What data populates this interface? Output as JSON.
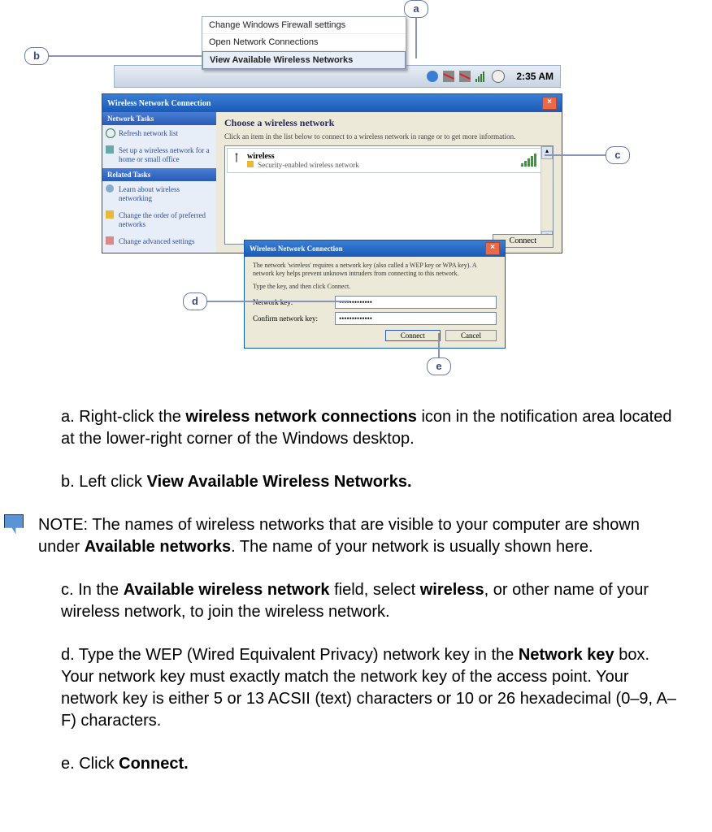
{
  "callouts": {
    "a": "a",
    "b": "b",
    "c": "c",
    "d": "d",
    "e": "e"
  },
  "contextMenu": {
    "item1": "Change Windows Firewall settings",
    "item2": "Open Network Connections",
    "item3": "View Available Wireless Networks"
  },
  "taskbar": {
    "clock": "2:35 AM"
  },
  "wnc": {
    "title": "Wireless Network Connection",
    "tasksHdr": "Network Tasks",
    "task1": "Refresh network list",
    "task2": "Set up a wireless network for a home or small office",
    "relatedHdr": "Related Tasks",
    "rel1": "Learn about wireless networking",
    "rel2": "Change the order of preferred networks",
    "rel3": "Change advanced settings",
    "mainHdr": "Choose a wireless network",
    "mainSub": "Click an item in the list below to connect to a wireless network in range or to get more information.",
    "netName": "wireless",
    "netSec": "Security-enabled wireless network",
    "connect": "Connect"
  },
  "keydlg": {
    "title": "Wireless Network Connection",
    "desc1": "The network 'wireless' requires a network key (also called a WEP key or WPA key). A network key helps prevent unknown intruders from connecting to this network.",
    "desc2": "Type the key, and then click Connect.",
    "lbl1": "Network key:",
    "lbl2": "Confirm network key:",
    "val": "•••••••••••••",
    "connect": "Connect",
    "cancel": "Cancel"
  },
  "text": {
    "a_pre": "a. Right-click the ",
    "a_b": "wireless network connections",
    "a_post": " icon in the notification area located at the lower-right corner of the Windows desktop.",
    "b_pre": "b. Left click ",
    "b_b": "View Available Wireless Networks.",
    "note_pre": "NOTE: The names of wireless networks that are visible to your computer are shown under ",
    "note_b": "Available networks",
    "note_post": ". The name of your network is usually shown here.",
    "c_pre": "c. In the ",
    "c_b1": "Available wireless network",
    "c_mid": " field, select ",
    "c_b2": "wireless",
    "c_post": ", or other name of your wireless network, to join the wireless network.",
    "d_pre": "d. Type the WEP (Wired Equivalent Privacy) network key in the ",
    "d_b": "Network key",
    "d_post": " box. Your network key must exactly match the network key of the access point. Your network key is either 5 or 13 ACSII (text) characters or 10 or 26 hexadecimal (0–9, A–F) characters.",
    "e_pre": "e. Click ",
    "e_b": "Connect."
  }
}
